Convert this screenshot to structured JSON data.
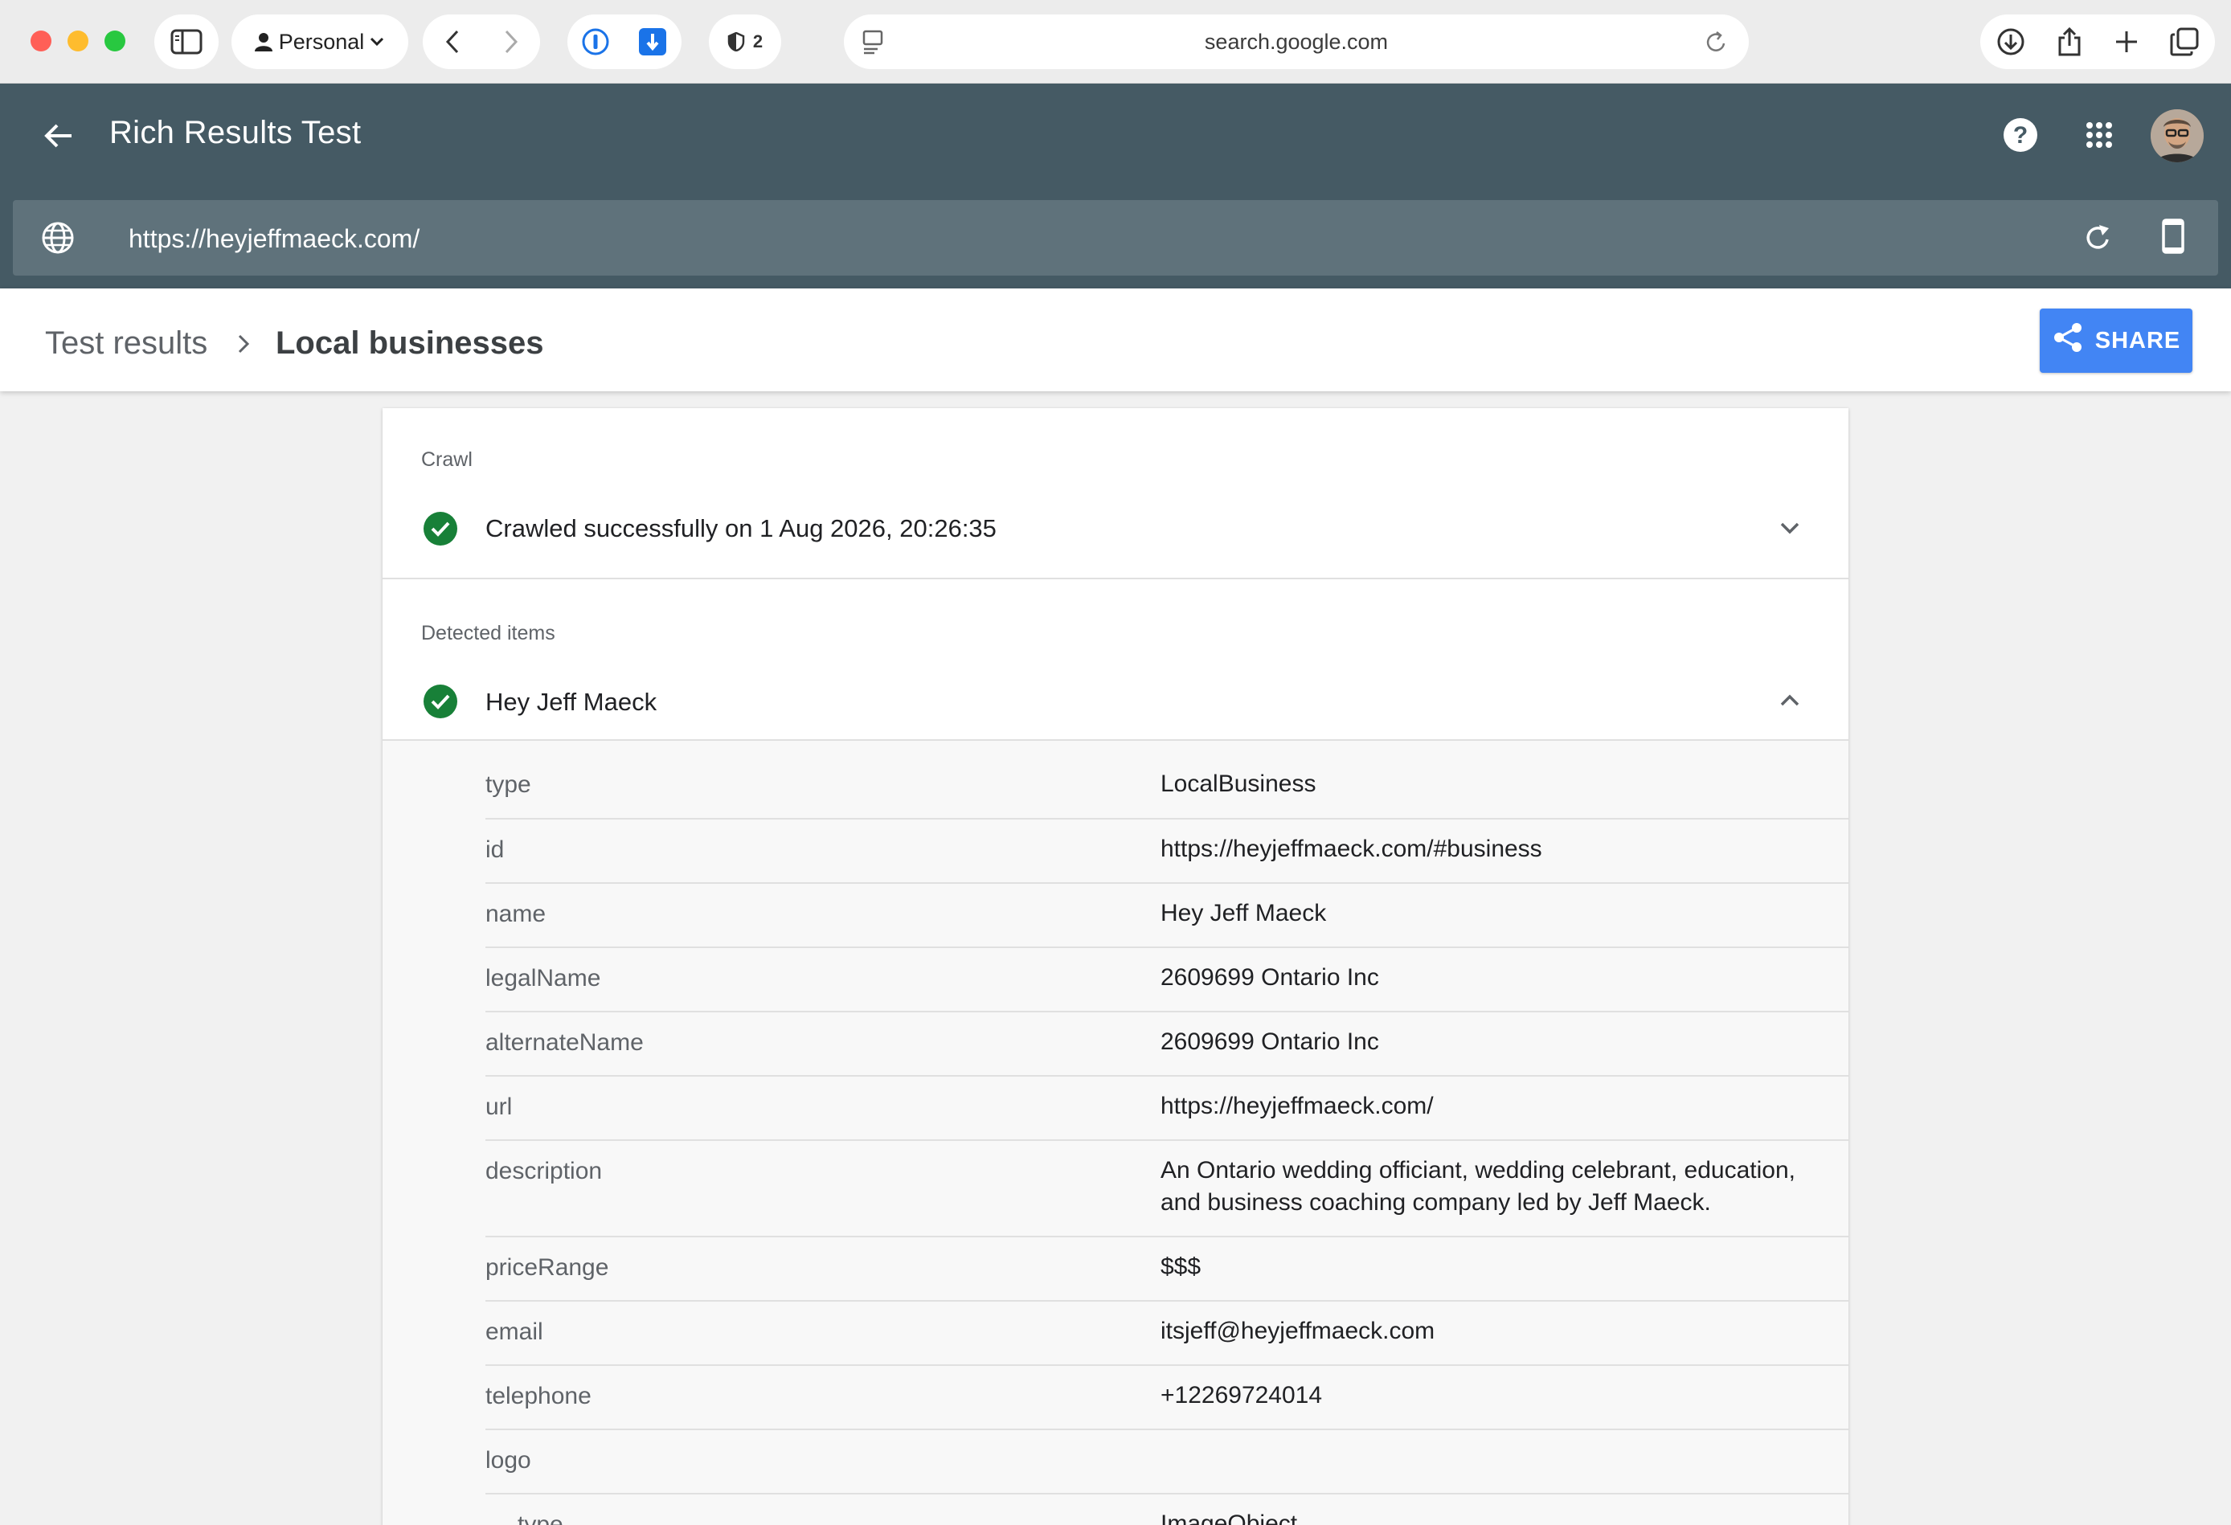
{
  "browser": {
    "profile_label": "Personal",
    "address": "search.google.com",
    "extension_badge_count": "2"
  },
  "app": {
    "title": "Rich Results Test",
    "tested_url": "https://heyjeffmaeck.com/"
  },
  "breadcrumb": {
    "parent": "Test results",
    "current": "Local businesses",
    "share_label": "SHARE"
  },
  "crawl": {
    "section_label": "Crawl",
    "status": "Crawled successfully on 1 Aug 2026, 20:26:35"
  },
  "detected": {
    "section_label": "Detected items",
    "item_name": "Hey Jeff Maeck",
    "properties": [
      {
        "key": "type",
        "value": "LocalBusiness"
      },
      {
        "key": "id",
        "value": "https://heyjeffmaeck.com/#business"
      },
      {
        "key": "name",
        "value": "Hey Jeff Maeck"
      },
      {
        "key": "legalName",
        "value": "2609699 Ontario Inc"
      },
      {
        "key": "alternateName",
        "value": "2609699 Ontario Inc"
      },
      {
        "key": "url",
        "value": "https://heyjeffmaeck.com/"
      },
      {
        "key": "description",
        "value": "An Ontario wedding officiant, wedding celebrant, education, and business coaching company led by Jeff Maeck."
      },
      {
        "key": "priceRange",
        "value": "$$$"
      },
      {
        "key": "email",
        "value": "itsjeff@heyjeffmaeck.com"
      },
      {
        "key": "telephone",
        "value": "+12269724014"
      },
      {
        "key": "logo",
        "value": ""
      },
      {
        "key": "type",
        "value": "ImageObject"
      }
    ]
  },
  "colors": {
    "appbar": "#455a64",
    "urlbar": "#5f727b",
    "share": "#4285f4",
    "success": "#188038"
  }
}
